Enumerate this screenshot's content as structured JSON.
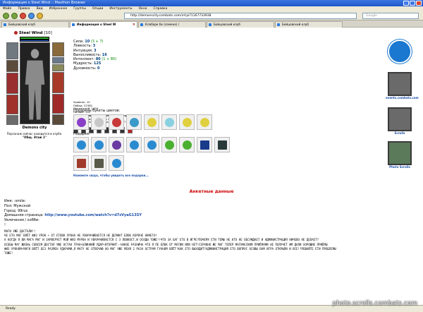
{
  "window": {
    "title": "Информация о Steel Wind :: Maxthon Browser"
  },
  "menu": [
    "Файл",
    "Правка",
    "Вид",
    "Избранное",
    "Группы",
    "Опции",
    "Инструменты",
    "Окно",
    "Справка"
  ],
  "address": {
    "url": "http://demonscity.combats.com/inf.pl?1167733938"
  },
  "search": {
    "placeholder": "Google"
  },
  "tabs": [
    {
      "label": "Бойцовский клуб"
    },
    {
      "label": "Информация о Steel W"
    },
    {
      "label": "Клабарк бк (семена) /"
    },
    {
      "label": "Бойцовский клуб"
    },
    {
      "label": "Бойцовский клуб"
    }
  ],
  "character": {
    "name": "Steel Wind",
    "level": "[10]",
    "city": "Demons city",
    "city_note": "Персонаж сейчас находится в клубе.",
    "location": "\"Общ. Этаж 1\""
  },
  "stats": [
    {
      "label": "Сила:",
      "value": "10",
      "extra": " (3 + 7)"
    },
    {
      "label": "Ловкость:",
      "value": "3",
      "extra": ""
    },
    {
      "label": "Интуиция:",
      "value": "3",
      "extra": ""
    },
    {
      "label": "Выносливость:",
      "value": "16",
      "extra": ""
    },
    {
      "label": "Интеллект:",
      "value": "80",
      "extra": " (1 + 80)"
    },
    {
      "label": "Мудрость:",
      "value": "125",
      "extra": ""
    },
    {
      "label": "Духовность:",
      "value": "0",
      "extra": ""
    }
  ],
  "info": [
    "Уровень: 10",
    "Побед: 22382",
    "Поражений: 1659",
    "Ничьих: 142",
    "Клан: DarkFire - Last Men Standing",
    "Место рождения: Devils city",
    "День рождения персонажа: 02.01.07 17:32"
  ],
  "flowers_label": "Подарены букеты цветов:",
  "gifts_label": "Подарки:",
  "gifts_link": "Нажмите сюда, чтобы увидеть все подарки...",
  "side": {
    "events_caption": "events.combats.com",
    "scrolls_caption": "Scrolls",
    "photo_caption": "Photo Scrolls"
  },
  "anket": {
    "title": "Анкетные данные",
    "name": "Имя: :smile:",
    "gender": "Пол: Мужской",
    "city": "Город: 99rus",
    "homepage_label": "Домашняя страница: ",
    "homepage_url": "http://www.youtube.com/watch?v=d7zVyaG13SY",
    "hobby": "Увлечения / хобби:",
    "hobby_value": "!",
    "about": [
      "МАГИ УЖЕ ДОСТАЛИ!!",
      "ЧЕ ЕТО МАГ ВЛЁТ ФИЗ УРОН + ОТ ЕТОВО УРОНА НЕ УВАРАЧИВАЕТСЯ НЕ ДЕРЖАТ БЛОК КОРОЧЕ НИЧЕГО!",
      "А КОГДА Я ВИ МАГА МАГ И ЗАРВЕРУЕТ МОЙ ФИЗ МУРОН И УВАРАЧИВАЕТСЯ С 3 ЛОВКОСТ,И ОСАДЫ ТОЖЕ!!ЧТО ЗА БАГ ЕТО В ИГРЕ?ПОЧЕМУ ЕТИ ТЕМЫ НЕ КТО НЕ ОБСУЖДАЕТ И АДМИНИСТРАЦИЯ НИЧЕВО НЕ ДЕЛАЕТ?",
      "ОСОБЫ МАГ ЖИЗНЬ СОВСЕМ ДОСТАЛ УЖЕ   ОСТАН ГРАН+БЛИННИЙ УДАР+ВТОРНИТ--НАКОЕ РАЗНИЧА ЧТО Я ПЕ БЛОК ОТ МАГИИ ИЛИ НЕТ!СЕРАВНО ЖЕ МАГ ТЕПЕР МАГИЧЕСКИМ ПРИЁМАМИ НЕ ПОЛУЧЕТ ИМ ДАЛИ ХОРОШИЕ ПРИЁМЫ",
      "ФИЗ УРОНОМ+МАГИ ВЛЁТ БЕЗ РАЗМЕН УДАРАМИ,Я МАГУ НЕ ОТВЕЧАЮ НО МАГ УЖЕ МЕНЯ 2 РАЗА ОСТРАМ ГУАНОМ ВЛЁТ!КАК ЕТО ВЫХОДИТ?АДМИНИСТРАЦИЯ ЕТО ВОПРОС ОСОВЫ ВАМ ИГРА ОТКРЫЛИ И ВСЕ!?РЕШАЙТЕ ЕТИ ПРОБЛЕМЫ",
      "ТОЖЕ!"
    ]
  },
  "status": {
    "text": "Ready"
  },
  "watermark": "photo.scrolls.combats.com",
  "colors": {
    "hp": "#2fb12f",
    "mp": "#2a5dd3",
    "title": "#c00000",
    "link": "#1a4fa8"
  }
}
